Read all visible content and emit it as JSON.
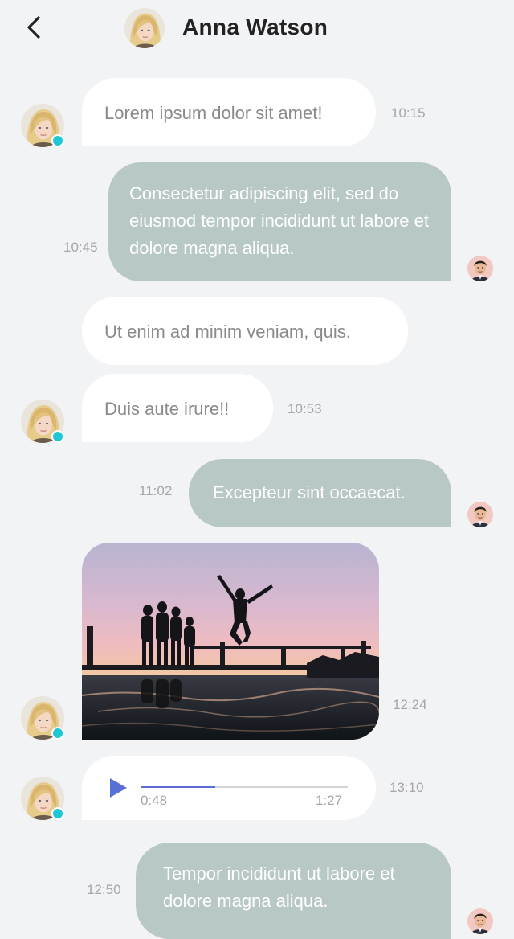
{
  "header": {
    "contact_name": "Anna Watson"
  },
  "messages": [
    {
      "text": "Lorem ipsum dolor sit amet!",
      "time": "10:15",
      "direction": "incoming"
    },
    {
      "text": "Consectetur adipiscing elit, sed do eiusmod tempor incididunt ut labore et dolore magna aliqua.",
      "time": "10:45",
      "direction": "outgoing"
    },
    {
      "text": "Ut enim ad minim veniam, quis.",
      "direction": "incoming"
    },
    {
      "text": "Duis aute irure!!",
      "time": "10:53",
      "direction": "incoming"
    },
    {
      "text": "Excepteur sint occaecat.",
      "time": "11:02",
      "direction": "outgoing"
    },
    {
      "type": "photo",
      "time": "12:24",
      "direction": "incoming"
    },
    {
      "type": "audio",
      "time": "13:10",
      "direction": "incoming",
      "elapsed": "0:48",
      "duration": "1:27",
      "progress": 0.36
    },
    {
      "text": "Tempor incididunt ut labore et dolore magna aliqua.",
      "time": "12:50",
      "direction": "outgoing"
    }
  ],
  "colors": {
    "background": "#f2f3f5",
    "incoming_bubble": "#ffffff",
    "outgoing_bubble": "#b8c8c6",
    "online_indicator": "#1dc7d6",
    "audio_accent": "#5a6fd6"
  },
  "icons": {
    "back": "chevron-left-icon",
    "play": "play-icon",
    "online": "online-status-icon"
  }
}
